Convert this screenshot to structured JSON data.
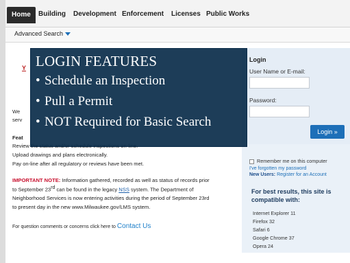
{
  "nav": {
    "tabs": [
      "Home",
      "Building",
      "Development",
      "Enforcement",
      "Licenses",
      "Public Works"
    ]
  },
  "subnav": {
    "advanced_search": "Advanced Search"
  },
  "main": {
    "partial_we": "We",
    "partial_serv": "serv",
    "features_heading": "Feat",
    "line_review": "Review the status and/or schedule inspections on-line.",
    "line_upload": "Upload drawings and plans electronically.",
    "line_pay": "Pay on-line after all regulatory or reviews have been met.",
    "important_label": "IMPORTANT NOTE:",
    "important_text1": "Information gathered, recorded  as well as status of records prior",
    "important_text2a": "to September 23",
    "important_sup": "rd",
    "important_text2b": " can be found in the legacy ",
    "nss": "NSS",
    "important_text2c": " system.  The Department of",
    "important_text3": "Neighborhood Services is now entering activities during the period of September 23rd",
    "important_text4": "to present day in the new www.Milwaukee.gov/LMS system.",
    "contact_prefix": "For question comments or concerns click here to ",
    "contact_link": "Contact Us"
  },
  "login": {
    "title": "Login",
    "user_label": "User Name or E-mail:",
    "password_label": "Password:",
    "button": "Login »",
    "remember": "Remember me on this computer",
    "forgot": "I've forgotten my password",
    "new_users_label": "New Users:",
    "new_users_link": "Register for an Account",
    "best_results": "For best results, this site is compatible with:",
    "browsers": [
      "Internet Explorer 11",
      "Firefox 32",
      "Safari 6",
      "Google Chrome 37",
      "Opera 24"
    ]
  },
  "overlay": {
    "heading": "LOGIN FEATURES",
    "bullets": [
      "Schedule an Inspection",
      "Pull a Permit",
      "NOT Required for Basic Search"
    ]
  },
  "colors": {
    "accent": "#1d6fb8",
    "overlay": "#0a2c4a",
    "important": "#c8102e"
  }
}
